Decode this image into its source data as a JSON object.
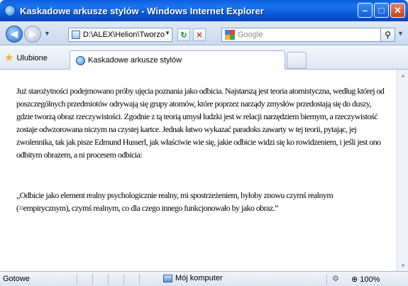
{
  "window": {
    "title": "Kaskadowe arkusze stylów - Windows Internet Explorer",
    "minimize_glyph": "–",
    "maximize_glyph": "□",
    "close_glyph": "✕"
  },
  "navigation": {
    "back_glyph": "◀",
    "forward_glyph": "▶",
    "dropdown_glyph": "▼",
    "address_value": "D:\\ALEX\\Helion\\Tworzo",
    "address_dropdown_glyph": "▼",
    "refresh_glyph": "↻",
    "stop_glyph": "✕",
    "search_placeholder": "Google",
    "search_glyph": "⚲",
    "more_glyph": "▼"
  },
  "favorites": {
    "label": "Ulubione"
  },
  "tabs": [
    {
      "label": "Kaskadowe arkusze stylów",
      "icon": "ie-page-icon"
    }
  ],
  "content": {
    "paragraph_1": "Już starożytności podejmowano próby ujęcia poznania jako odbicia. Najstarszą jest teoria atomistyczna, według której od poszczególnych przedmiotów odrywają się grupy atomów, które poprzez narządy zmysłów przedostają się do duszy, gdzie tworzą obraz rzeczywistości. Zgodnie z tą teorią umysł ludzki jest w relacji narzędziem biernym, a rzeczywistość zostaje odwzorowana niczym na czystej kartce. Jednak łatwo wykazać paradoks zawarty w tej teorii, pytając, jej zwolennika, tak jak pisze Edmund Husserl, jak właściwie wie się, jakie odbicie widzi się ko rowidzeniem, i jeśli jest ono odbitym obrazem, a ni procesem odbicia:",
    "paragraph_2": "„Odbicie jako element realny psychologicznie realny, mi spostrzeżeniem, byłoby znowu czymś realnym (=empirycznym), czymś realnym, co dla czego innego funkcjonowało by jako obraz.”"
  },
  "status": {
    "text": "Gotowe",
    "zone": "Mój komputer",
    "protected_glyph": "⚙",
    "zoom": "100%",
    "zoom_glyph": "⊕"
  },
  "colors": {
    "title_bar": "#0a5fdc",
    "toolbar": "#dfe9f6",
    "favorites_star": "#f4b42a"
  }
}
